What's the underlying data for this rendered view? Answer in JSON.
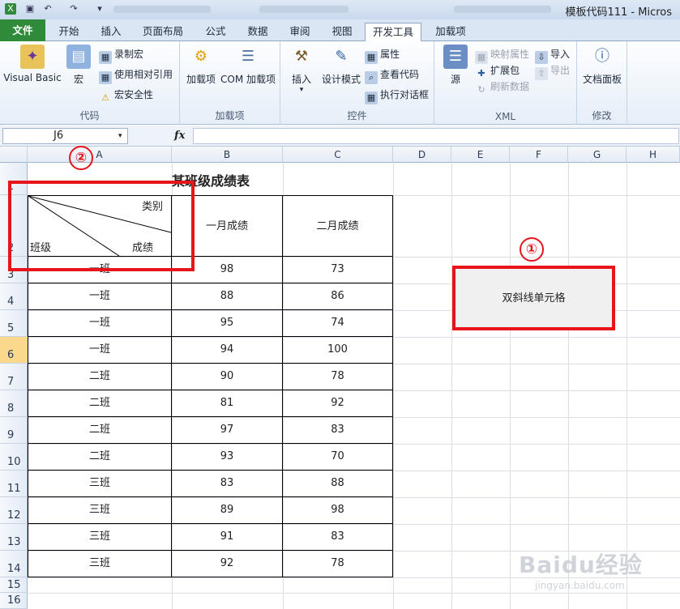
{
  "window": {
    "title": "模板代码111 - Micros"
  },
  "tabs": [
    "文件",
    "开始",
    "插入",
    "页面布局",
    "公式",
    "数据",
    "审阅",
    "视图",
    "开发工具",
    "加载项"
  ],
  "ribbon": {
    "code": {
      "label": "代码",
      "visual_basic": "Visual Basic",
      "macro": "宏",
      "record_macro": "录制宏",
      "relative_ref": "使用相对引用",
      "macro_security": "宏安全性"
    },
    "addins": {
      "label": "加载项",
      "addins": "加载项",
      "com_addins": "COM 加载项"
    },
    "controls": {
      "label": "控件",
      "insert": "插入",
      "design_mode": "设计模式",
      "properties": "属性",
      "view_code": "查看代码",
      "run_dialog": "执行对话框"
    },
    "xml": {
      "label": "XML",
      "source": "源",
      "map_properties": "映射属性",
      "expansion_packs": "扩展包",
      "refresh_data": "刷新数据",
      "import": "导入",
      "export": "导出"
    },
    "modify": {
      "label": "修改",
      "document_panel": "文档面板"
    }
  },
  "formula_bar": {
    "name_box": "J6",
    "fx": "fx",
    "value": ""
  },
  "columns": [
    "A",
    "B",
    "C",
    "D",
    "E",
    "F",
    "G",
    "H"
  ],
  "rows": [
    "1",
    "2",
    "3",
    "4",
    "5",
    "6",
    "7",
    "8",
    "9",
    "10",
    "11",
    "12",
    "13",
    "14",
    "15",
    "16"
  ],
  "selected_row": "6",
  "sheet": {
    "title": "某班级成绩表",
    "diag_top": "类别",
    "diag_bottom_left": "班级",
    "diag_bottom_right": "成绩",
    "headers": [
      "一月成绩",
      "二月成绩"
    ],
    "data": [
      [
        "一班",
        "98",
        "73"
      ],
      [
        "一班",
        "88",
        "86"
      ],
      [
        "一班",
        "95",
        "74"
      ],
      [
        "一班",
        "94",
        "100"
      ],
      [
        "二班",
        "90",
        "78"
      ],
      [
        "二班",
        "81",
        "92"
      ],
      [
        "二班",
        "97",
        "83"
      ],
      [
        "二班",
        "93",
        "70"
      ],
      [
        "三班",
        "83",
        "88"
      ],
      [
        "三班",
        "89",
        "98"
      ],
      [
        "三班",
        "91",
        "83"
      ],
      [
        "三班",
        "92",
        "78"
      ]
    ]
  },
  "shape_button": "双斜线单元格",
  "annotations": [
    "①",
    "②"
  ],
  "watermark": {
    "brand": "Baidu经验",
    "url": "jingyan.baidu.com"
  }
}
